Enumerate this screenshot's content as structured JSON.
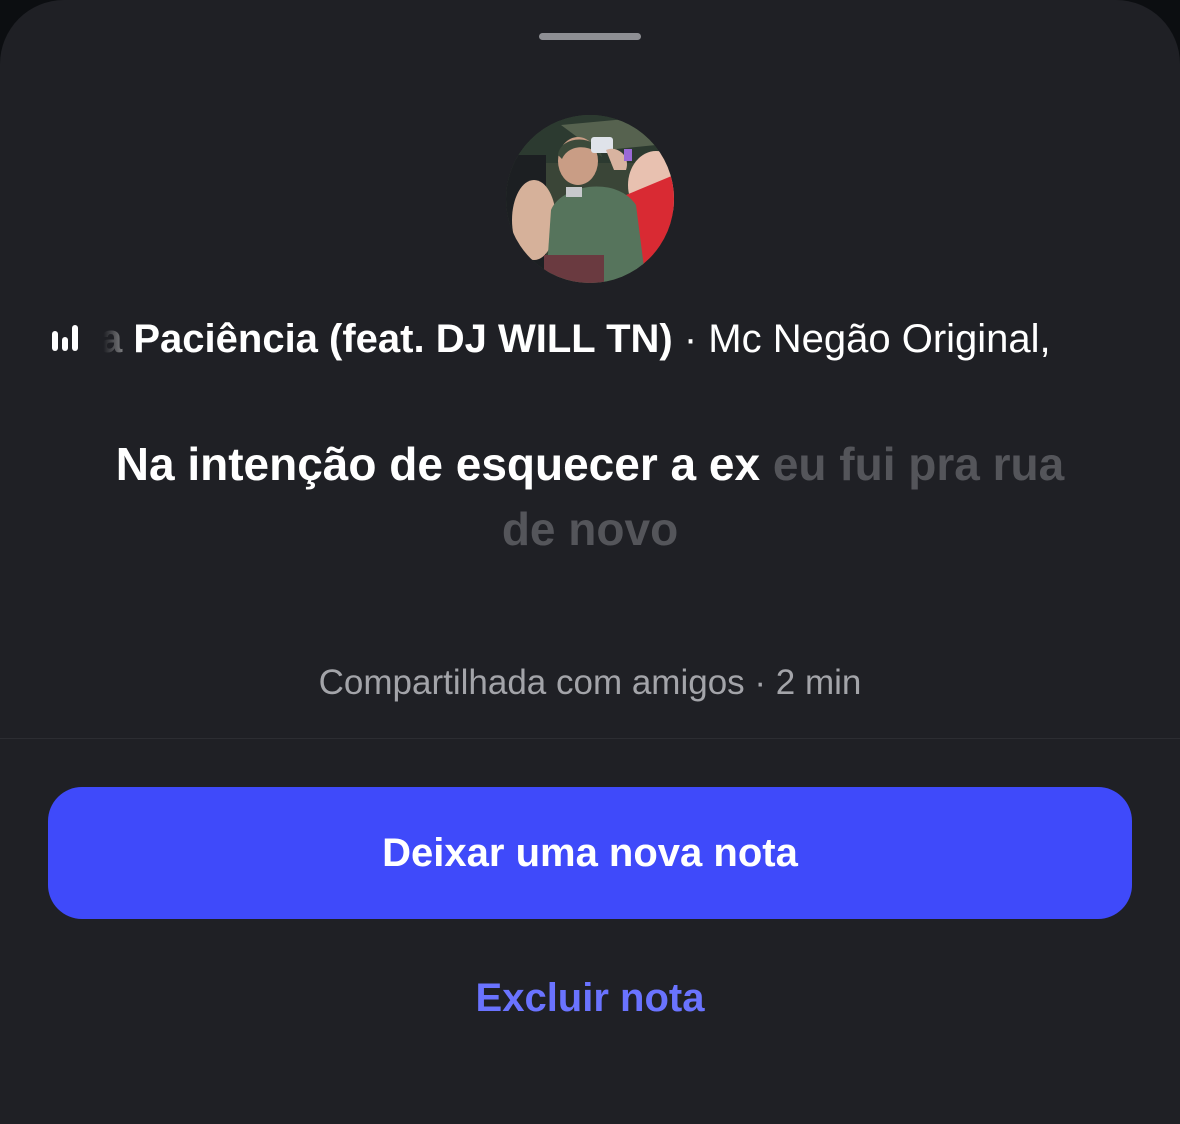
{
  "note": {
    "song": {
      "title_fragment": "a Paciência (feat. DJ WILL TN)",
      "separator": " · ",
      "artist": "Mc Negão Original,",
      "playing_icon": "equalizer-bars-icon"
    },
    "lyric": {
      "sung": "Na intenção de esquecer a ex",
      "unsung": "eu fui pra rua de novo"
    },
    "meta": {
      "audience": "Compartilhada com amigos",
      "separator": " · ",
      "time_ago": "2 min"
    }
  },
  "actions": {
    "new_note_label": "Deixar uma nova nota",
    "delete_note_label": "Excluir nota"
  },
  "colors": {
    "sheet_background": "#1f2025",
    "primary_button": "#3f4afa",
    "secondary_link": "#6a73ff",
    "muted_text": "#a3a4a9",
    "unsung_lyric": "#54555a"
  }
}
